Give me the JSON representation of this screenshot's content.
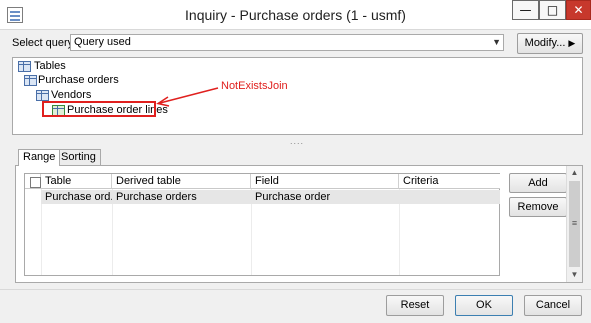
{
  "window": {
    "title": "Inquiry - Purchase orders (1 - usmf)",
    "min_glyph": "—",
    "max_glyph": "□",
    "close_glyph": "✕"
  },
  "query": {
    "label": "Select query:",
    "value": "Query used",
    "modify_label": "Modify..."
  },
  "tree": {
    "root": "Tables",
    "nodes": [
      {
        "label": "Purchase orders"
      },
      {
        "label": "Vendors"
      },
      {
        "label": "Purchase order lines",
        "highlighted": true
      }
    ]
  },
  "annotation": {
    "text": "NotExistsJoin",
    "color": "#e0201e"
  },
  "tabs": [
    {
      "label": "Range",
      "active": true
    },
    {
      "label": "Sorting",
      "active": false
    }
  ],
  "grid": {
    "columns": [
      "Table",
      "Derived table",
      "Field",
      "Criteria"
    ],
    "rows": [
      {
        "table": "Purchase ord...",
        "derived_table": "Purchase orders",
        "field": "Purchase order",
        "criteria": ""
      }
    ]
  },
  "side_buttons": {
    "add": "Add",
    "remove": "Remove"
  },
  "footer": {
    "reset": "Reset",
    "ok": "OK",
    "cancel": "Cancel"
  },
  "colors": {
    "accent": "#3c7fb1",
    "close": "#c7382c"
  }
}
